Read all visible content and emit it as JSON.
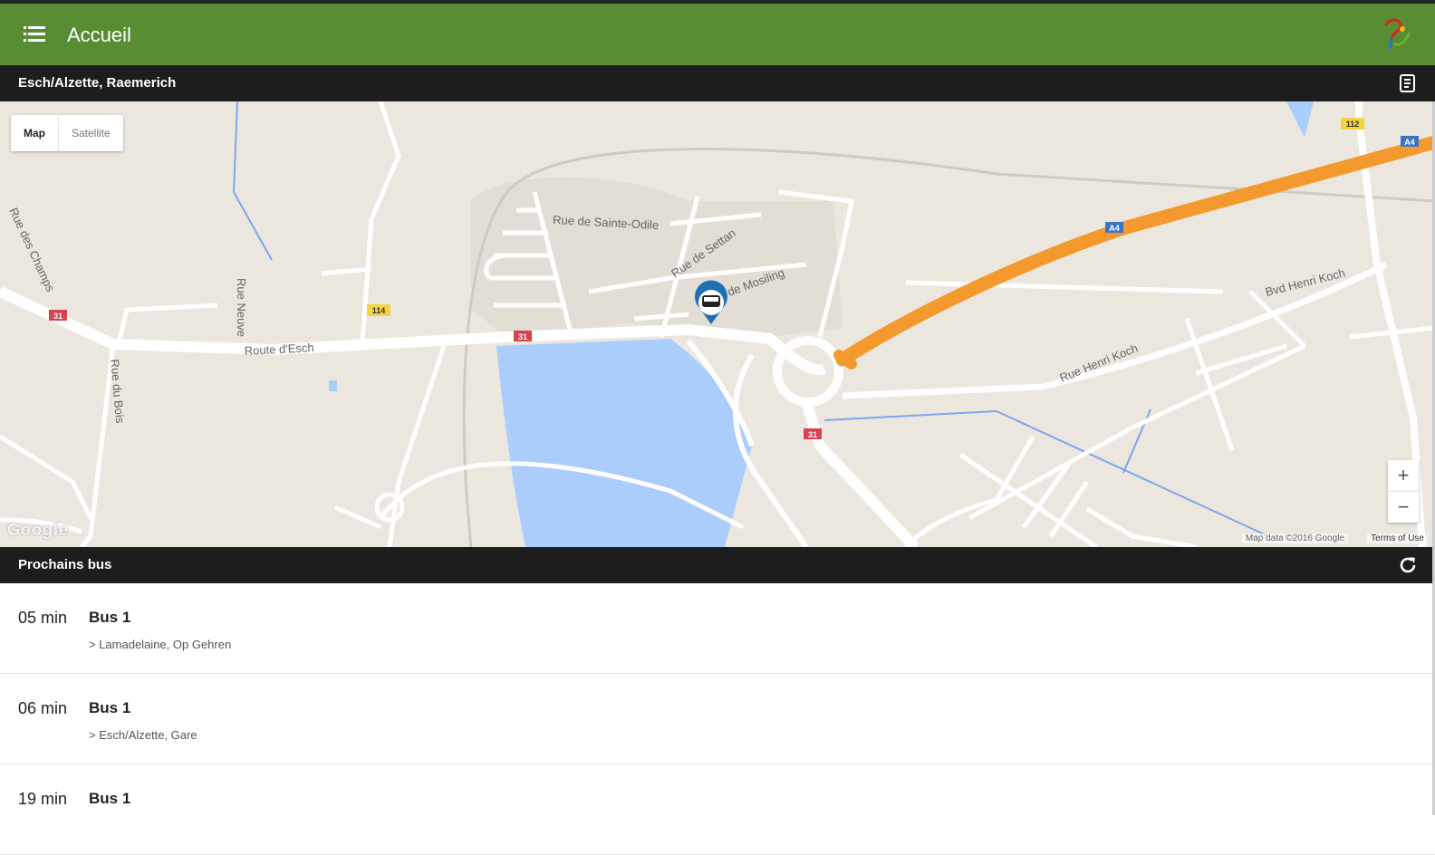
{
  "app": {
    "title": "Accueil"
  },
  "stop": {
    "name": "Esch/Alzette, Raemerich"
  },
  "map": {
    "type_map": "Map",
    "type_satellite": "Satellite",
    "zoom_in": "+",
    "zoom_out": "−",
    "google_logo": "Google",
    "attribution": "Map data ©2016 Google",
    "terms": "Terms of Use",
    "labels": {
      "route_esch": "Route d'Esch",
      "rue_sainte_odile": "Rue de Sainte-Odile",
      "rue_de_settan": "Rue de Settan",
      "rue_mosiling": "de Mosiling",
      "rue_des_champs": "Rue des Champs",
      "rue_neuve": "Rue Neuve",
      "rue_du_bois": "Rue du Bois",
      "bvd_henri_koch": "Bvd Henri Koch",
      "rue_henri_koch": "Rue Henri Koch",
      "shield_31_a": "31",
      "shield_31_b": "31",
      "shield_31_c": "31",
      "shield_114": "114",
      "shield_112": "112",
      "shield_a4_a": "A4",
      "shield_a4_b": "A4"
    }
  },
  "next_buses": {
    "title": "Prochains bus",
    "items": [
      {
        "time": "05 min",
        "line": "Bus 1",
        "destination": "> Lamadelaine, Op Gehren"
      },
      {
        "time": "06 min",
        "line": "Bus 1",
        "destination": "> Esch/Alzette, Gare"
      },
      {
        "time": "19 min",
        "line": "Bus 1",
        "destination": ""
      }
    ]
  },
  "colors": {
    "toolbar": "#598d33",
    "section_bar": "#1d1d1d",
    "highway": "#f4992d",
    "water": "#abcdfb",
    "marker": "#1e6fb5"
  }
}
